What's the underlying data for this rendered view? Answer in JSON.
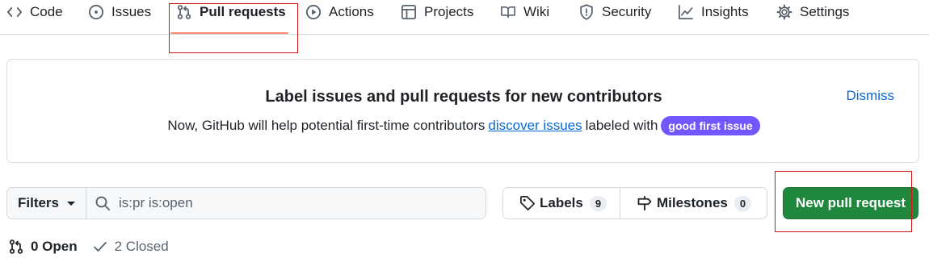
{
  "nav": {
    "items": [
      {
        "label": "Code",
        "icon": "code-icon"
      },
      {
        "label": "Issues",
        "icon": "issue-opened-icon"
      },
      {
        "label": "Pull requests",
        "icon": "git-pull-request-icon",
        "selected": true
      },
      {
        "label": "Actions",
        "icon": "play-icon"
      },
      {
        "label": "Projects",
        "icon": "table-icon"
      },
      {
        "label": "Wiki",
        "icon": "book-icon"
      },
      {
        "label": "Security",
        "icon": "shield-icon"
      },
      {
        "label": "Insights",
        "icon": "graph-icon"
      },
      {
        "label": "Settings",
        "icon": "gear-icon"
      }
    ]
  },
  "banner": {
    "title": "Label issues and pull requests for new contributors",
    "text_before": "Now, GitHub will help potential first-time contributors",
    "link_text": "discover issues",
    "text_after": "labeled with",
    "label": "good first issue",
    "dismiss": "Dismiss"
  },
  "toolbar": {
    "filters_label": "Filters",
    "search_value": "is:pr is:open",
    "labels_label": "Labels",
    "labels_count": "9",
    "milestones_label": "Milestones",
    "milestones_count": "0",
    "new_pr_label": "New pull request"
  },
  "states": {
    "open_label": "0 Open",
    "closed_label": "2 Closed"
  },
  "colors": {
    "primary_button": "#1f883d",
    "link": "#0969da",
    "good_first_issue_label": "#7057ff",
    "selected_tab_underline": "#fd8c73",
    "annotation_box": "#d11414"
  }
}
